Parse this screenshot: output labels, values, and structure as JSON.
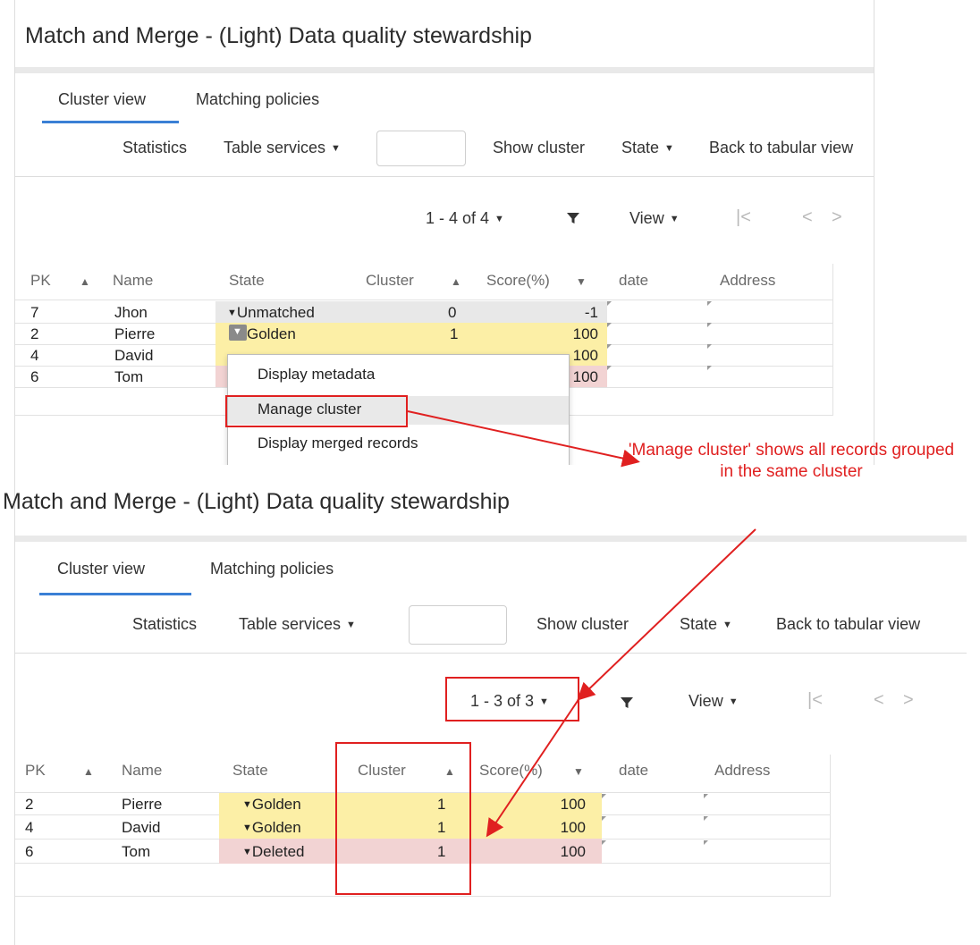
{
  "top": {
    "title": "Match and Merge - (Light) Data quality stewardship",
    "tabs": [
      "Cluster view",
      "Matching policies"
    ],
    "toolbar": {
      "statistics": "Statistics",
      "table_services": "Table services",
      "show_cluster": "Show cluster",
      "state": "State",
      "back": "Back to tabular view"
    },
    "pager": "1 - 4 of 4",
    "view": "View",
    "columns": [
      "PK",
      "Name",
      "State",
      "Cluster",
      "Score(%)",
      "date",
      "Address"
    ],
    "rows": [
      {
        "pk": "7",
        "name": "Jhon",
        "state": "Unmatched",
        "cluster": "0",
        "score": "-1"
      },
      {
        "pk": "2",
        "name": "Pierre",
        "state": "Golden",
        "cluster": "1",
        "score": "100"
      },
      {
        "pk": "4",
        "name": "David",
        "state": "",
        "cluster": "",
        "score": "100"
      },
      {
        "pk": "6",
        "name": "Tom",
        "state": "",
        "cluster": "",
        "score": "100"
      }
    ],
    "menu": [
      "Display metadata",
      "Manage cluster",
      "Display merged records"
    ]
  },
  "bottom": {
    "title": "Match and Merge - (Light) Data quality stewardship",
    "tabs": [
      "Cluster view",
      "Matching policies"
    ],
    "toolbar": {
      "statistics": "Statistics",
      "table_services": "Table services",
      "show_cluster": "Show cluster",
      "state": "State",
      "back": "Back to tabular view"
    },
    "pager": "1 - 3 of 3",
    "view": "View",
    "columns": [
      "PK",
      "Name",
      "State",
      "Cluster",
      "Score(%)",
      "date",
      "Address"
    ],
    "rows": [
      {
        "pk": "2",
        "name": "Pierre",
        "state": "Golden",
        "cluster": "1",
        "score": "100"
      },
      {
        "pk": "4",
        "name": "David",
        "state": "Golden",
        "cluster": "1",
        "score": "100"
      },
      {
        "pk": "6",
        "name": "Tom",
        "state": "Deleted",
        "cluster": "1",
        "score": "100"
      }
    ]
  },
  "annotation": "'Manage cluster' shows all records grouped in the same cluster",
  "colors": {
    "golden": "#fcefa6",
    "deleted": "#f2d3d3",
    "unmatched": "#e8e8e8",
    "accent": "#3a7fd5",
    "annotation": "#e02020"
  }
}
